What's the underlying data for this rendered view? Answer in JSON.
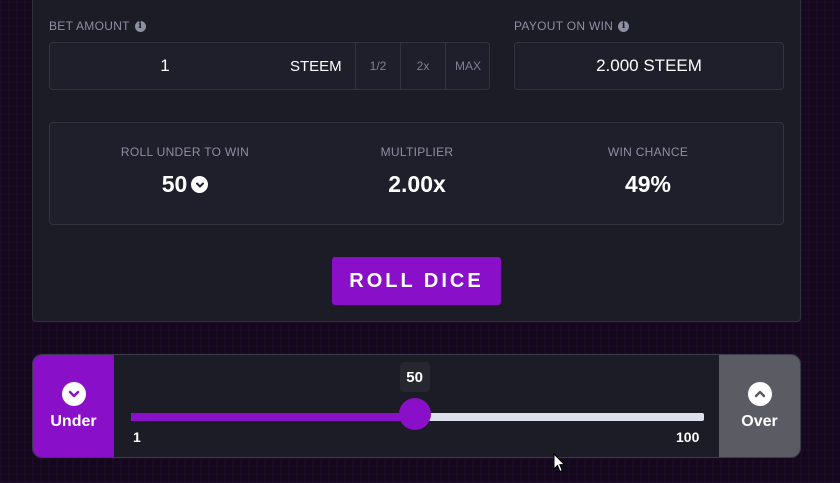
{
  "bet": {
    "label": "BET AMOUNT",
    "value": "1",
    "currency": "STEEM",
    "half_label": "1/2",
    "double_label": "2x",
    "max_label": "MAX"
  },
  "payout": {
    "label": "PAYOUT ON WIN",
    "value": "2.000 STEEM"
  },
  "stats": {
    "roll_under_label": "ROLL UNDER TO WIN",
    "roll_under_value": "50",
    "multiplier_label": "MULTIPLIER",
    "multiplier_value": "2.00x",
    "win_chance_label": "WIN CHANCE",
    "win_chance_value": "49%"
  },
  "roll_button": {
    "label": "ROLL DICE"
  },
  "slider": {
    "under_label": "Under",
    "over_label": "Over",
    "value": 50,
    "value_label": "50",
    "min": 1,
    "max": 100,
    "min_label": "1",
    "max_label": "100"
  },
  "icons": {
    "info": "info-icon",
    "dropdown": "chevron-down-icon",
    "under": "chevron-down-circle-icon",
    "over": "chevron-up-circle-icon",
    "cursor": "mouse-pointer-icon"
  },
  "colors": {
    "accent": "#8a0fc8",
    "panel": "#1b1c26",
    "field": "#1e1f2a",
    "muted_text": "#8d8fa3",
    "over_button": "#5a5b63",
    "track": "#dde1ee"
  }
}
